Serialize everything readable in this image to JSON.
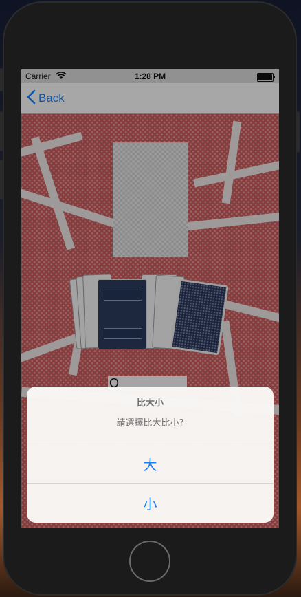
{
  "status_bar": {
    "carrier": "Carrier",
    "time": "1:28 PM"
  },
  "nav": {
    "back_label": "Back"
  },
  "game": {
    "rank_letter": "Q"
  },
  "alert": {
    "title": "比大小",
    "message": "請選擇比大比小?",
    "actions": [
      {
        "label": "大"
      },
      {
        "label": "小"
      }
    ]
  },
  "icons": [
    "wifi-icon",
    "battery-icon",
    "chevron-left-icon"
  ],
  "colors": {
    "accent": "#147efb",
    "felt": "#c85a5a",
    "card_back_navy": "#2c3a5a"
  }
}
